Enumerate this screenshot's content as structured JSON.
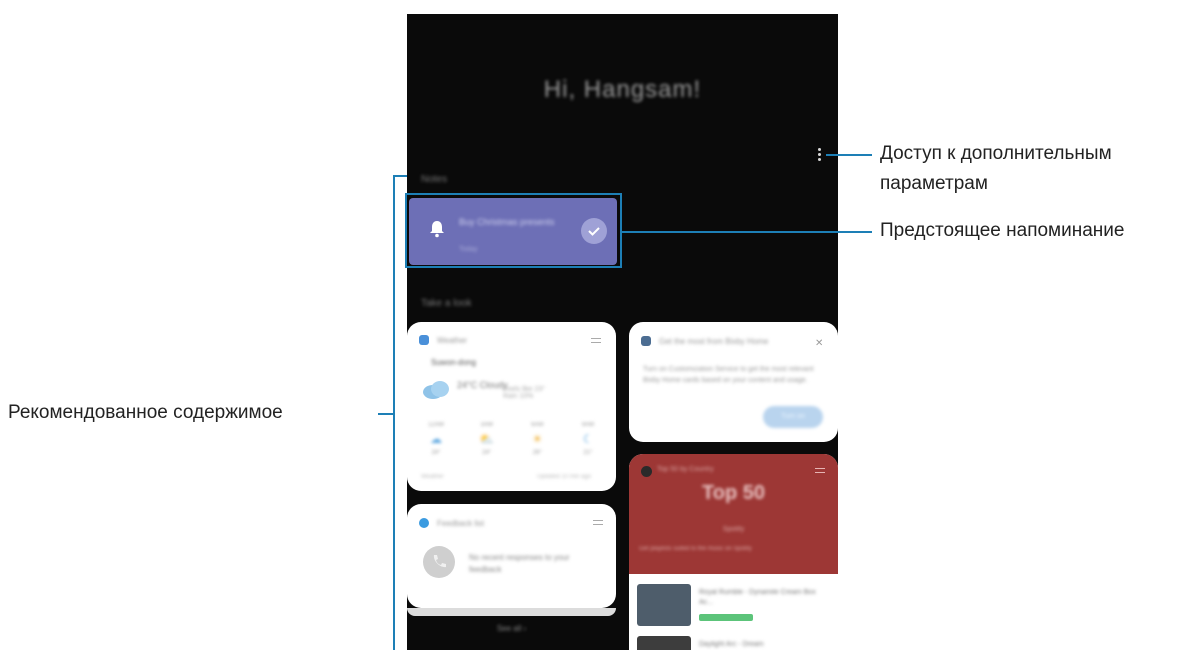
{
  "screen": {
    "greeting": "Hi, Hangsam!",
    "reminder_section": "Notes",
    "reminder": {
      "title": "Buy Christmas presents",
      "subtitle": "Today"
    },
    "content_section": "Take a look",
    "weather_card": {
      "app": "Weather",
      "location": "Suwon-dong",
      "temp": "24°C  Cloudy",
      "desc": "Feels like 23° Rain 10%",
      "forecast": [
        {
          "time": "12AM",
          "icon": "☁",
          "temp": "24°"
        },
        {
          "time": "3AM",
          "icon": "⛅",
          "temp": "24°"
        },
        {
          "time": "6AM",
          "icon": "☀",
          "temp": "26°"
        },
        {
          "time": "9AM",
          "icon": "☾",
          "temp": "21°"
        }
      ],
      "footer_left": "Weather",
      "footer_right": "Updated 10 min ago"
    },
    "bixby_card": {
      "title": "Get the most from Bixby Home",
      "text": "Turn on Customization Service to get the most relevant Bixby Home cards based on your content and usage.",
      "button": "Turn on"
    },
    "music_card": {
      "title": "Top 50 by Country",
      "big": "Top 50",
      "sub": "Spotify",
      "note": "Get playlists suited to the music on Spotify",
      "tracks": [
        {
          "title": "Royal Rumble - Dynamite Cream Box Ac..."
        },
        {
          "title": "Daylight Arc - Dream"
        }
      ]
    },
    "feedback_card": {
      "title": "Feedback list",
      "text": "No recent responses to your feedback"
    },
    "see_all": "See all ›"
  },
  "callouts": {
    "more_options": "Доступ к дополнительным параметрам",
    "upcoming_reminder": "Предстоящее напоминание",
    "recommended_content": "Рекомендованное содержимое"
  },
  "colors": {
    "callout_blue": "#1d7fb6",
    "reminder_purple": "#6d6fb6",
    "music_red": "#9d3735"
  }
}
